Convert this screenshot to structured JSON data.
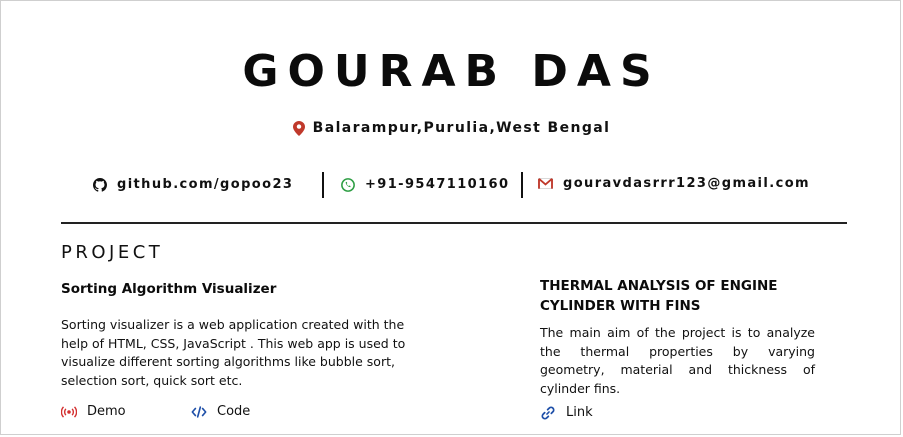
{
  "header": {
    "name": "GOURAB DAS",
    "location": "Balarampur,Purulia,West Bengal"
  },
  "contacts": {
    "github": "github.com/gopoo23",
    "phone": "+91-9547110160",
    "email": "gouravdasrrr123@gmail.com"
  },
  "section": {
    "title": "PROJECT"
  },
  "projects": [
    {
      "title": "Sorting Algorithm Visualizer",
      "description": "Sorting visualizer is a web application created with the help of HTML, CSS, JavaScript . This web app is used to visualize different sorting algorithms like bubble sort, selection sort, quick sort etc.",
      "links": [
        {
          "label": "Demo",
          "icon": "broadcast-icon"
        },
        {
          "label": "Code",
          "icon": "code-icon"
        }
      ]
    },
    {
      "title": "THERMAL ANALYSIS OF ENGINE CYLINDER WITH FINS",
      "description": "The main aim of the project is to analyze the thermal properties by varying geometry, material and thickness of cylinder fins.",
      "links": [
        {
          "label": "Link",
          "icon": "link-icon"
        }
      ]
    }
  ],
  "colors": {
    "pin": "#c0392b",
    "phone": "#2e9e44",
    "email": "#c0392b",
    "demo": "#d32f2f",
    "code": "#1e4fa8",
    "link": "#1e4fa8"
  }
}
